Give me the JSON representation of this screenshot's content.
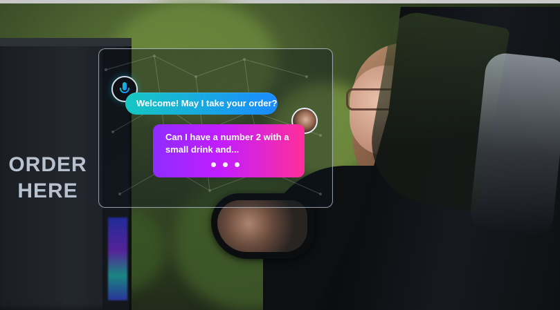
{
  "kiosk": {
    "sign_text": "ORDER\nHERE"
  },
  "conversation": {
    "bot_icon": "mic-icon",
    "bot_message": "Welcome! May I take your order?",
    "user_message": "Can I have a number 2 with a small drink and...",
    "typing_dots": "• • •"
  },
  "colors": {
    "bot_bubble_start": "#16c7c2",
    "bot_bubble_end": "#1a8bff",
    "user_bubble_start": "#8f2cff",
    "user_bubble_end": "#ff2f9a",
    "panel_border": "#d2e1f0"
  }
}
